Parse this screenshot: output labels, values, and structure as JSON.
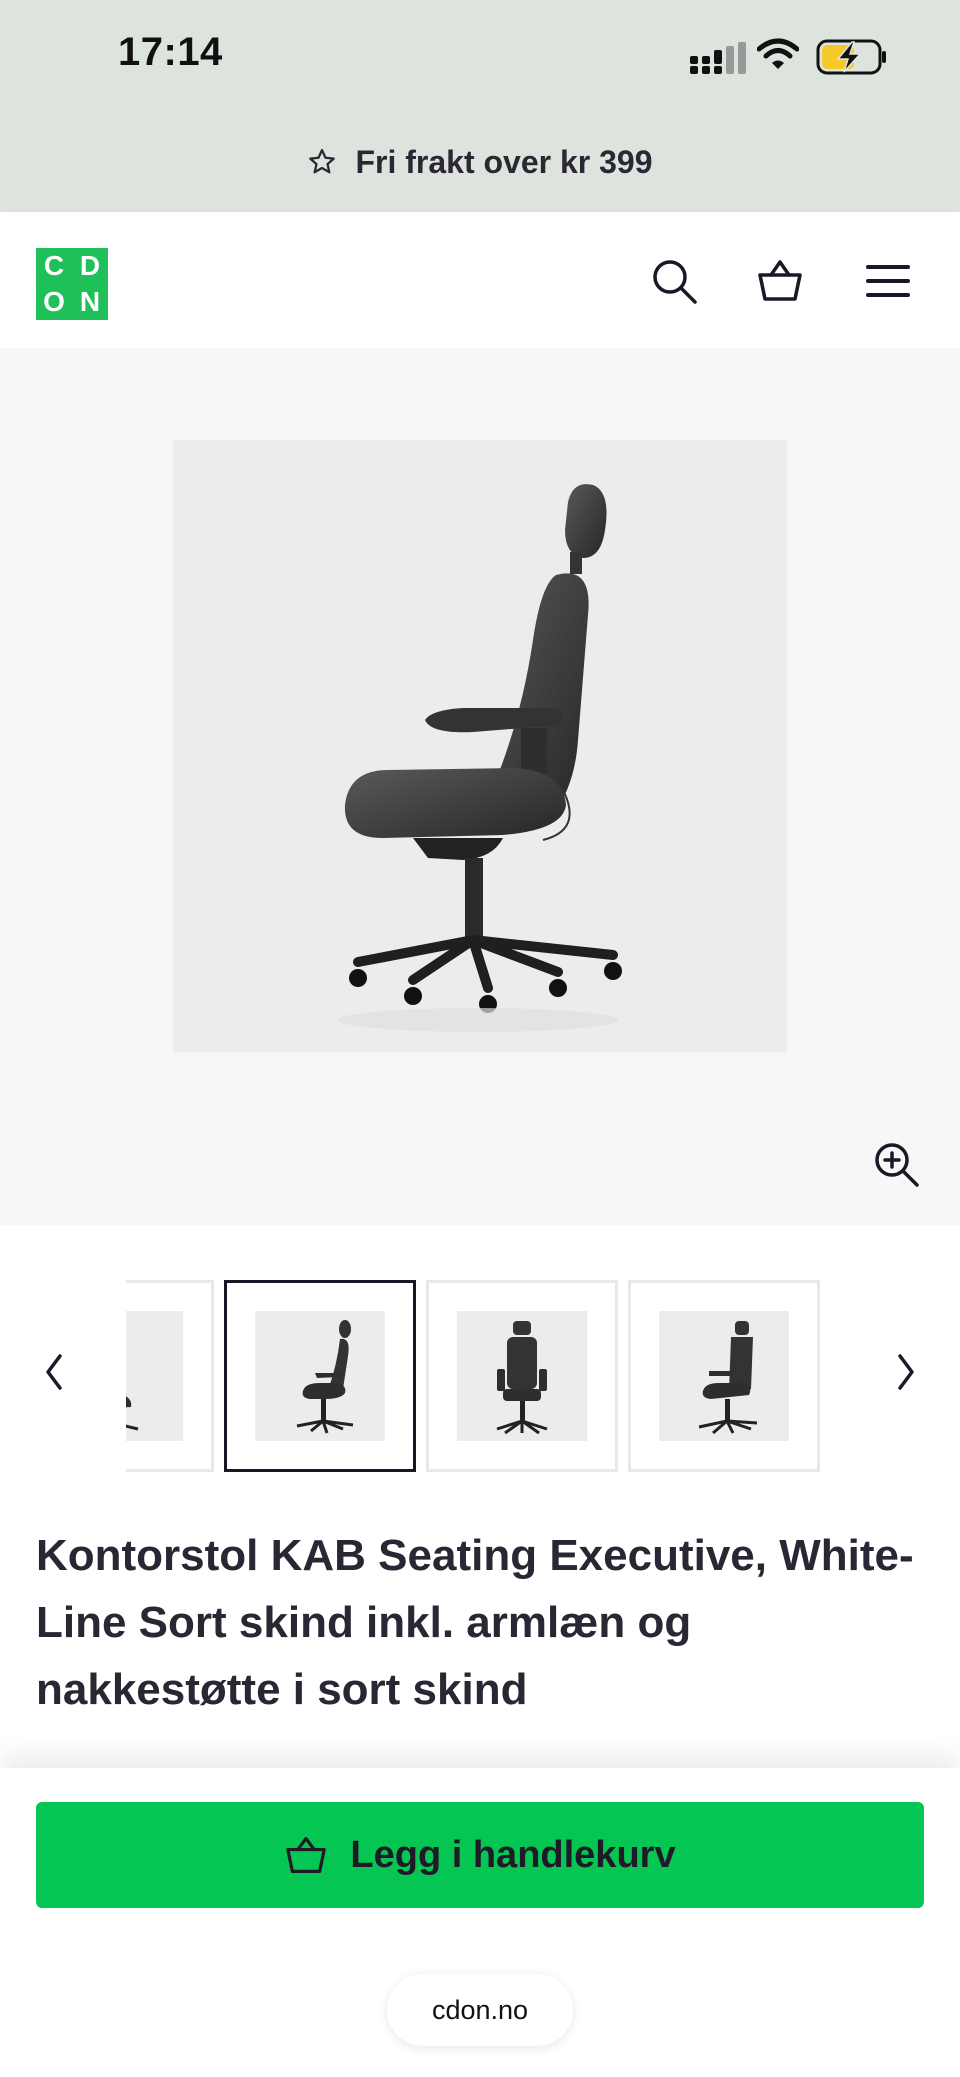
{
  "status_bar": {
    "time": "17:14",
    "icons": [
      "cellular-signal-icon",
      "wifi-icon",
      "battery-charging-icon"
    ],
    "battery_color": "#f5c92a"
  },
  "promo": {
    "icon": "star-icon",
    "text": "Fri frakt over kr 399"
  },
  "header": {
    "logo": [
      "C",
      "D",
      "O",
      "N"
    ],
    "logo_color": "#1fbf5a",
    "icons": [
      "search-icon",
      "basket-icon",
      "menu-icon"
    ]
  },
  "gallery": {
    "main_image": "office-chair-side-view",
    "zoom_icon": "zoom-in-icon",
    "thumbnails": [
      {
        "view": "partial-side",
        "active": false
      },
      {
        "view": "side",
        "active": true
      },
      {
        "view": "front",
        "active": false
      },
      {
        "view": "three-quarter",
        "active": false
      }
    ],
    "prev_icon": "chevron-left-icon",
    "next_icon": "chevron-right-icon"
  },
  "product": {
    "title": "Kontorstol KAB Seating Executive, White-Line Sort skind inkl. armlæn og nakkestøtte i sort skind"
  },
  "cta": {
    "label": "Legg i handlekurv",
    "color": "#05c653"
  },
  "browser": {
    "url": "cdon.no"
  }
}
